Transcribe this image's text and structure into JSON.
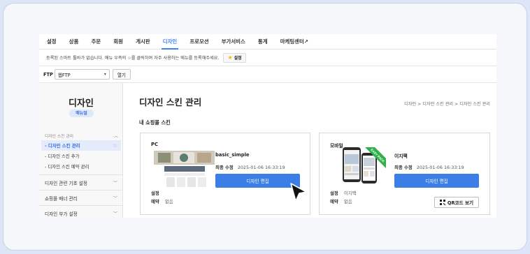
{
  "topnav": {
    "items": [
      "설정",
      "상품",
      "주문",
      "회원",
      "게시판",
      "디자인",
      "프로모션",
      "부가서비스",
      "통계",
      "마케팅센터↗"
    ],
    "active_index": 5
  },
  "notice": {
    "text": "등록된 스마트 툴바가 없습니다. 메뉴 우측의 ☆를 클릭하여 자주 사용하는 메뉴를 등록해주세요.",
    "button_label": "설정"
  },
  "ftp": {
    "label": "FTP",
    "selected": "웹FTP",
    "open_label": "열기"
  },
  "sidebar": {
    "title": "디자인",
    "manual_label": "매뉴얼",
    "section_label": "디자인 스킨 관리",
    "sub_items": [
      "디자인 스킨 관리",
      "디자인 스킨 추가",
      "디자인 스킨 예약 관리"
    ],
    "menus": [
      "디자인 관련 기초 설정",
      "쇼핑몰 배너 관리",
      "디자인 부가 설정"
    ]
  },
  "main": {
    "title": "디자인 스킨 관리",
    "breadcrumb": "디자인 > 디자인 스킨 관리 > 디자인 스킨 관리",
    "section_title": "내 쇼핑몰 스킨",
    "pc": {
      "label": "PC",
      "skin_name": "basic_simple",
      "modified_label": "최종 수정",
      "modified_value": "2025-01-06 16:33:19",
      "edit_label": "디자인 편집",
      "setting_label": "설정",
      "setting_value": "",
      "reserve_label": "예약",
      "reserve_value": "없음"
    },
    "mobile": {
      "label": "모바일",
      "skin_name": "이지팩",
      "badge": "EASY PACK",
      "modified_label": "최종 수정",
      "modified_value": "2025-01-06 16:33:19",
      "edit_label": "디자인 편집",
      "setting_label": "설정",
      "setting_value": "이지팩",
      "reserve_label": "예약",
      "reserve_value": "없음",
      "qr_label": "QR코드 보기"
    }
  },
  "colors": {
    "accent": "#3a7ee6",
    "badge_green": "#2fb14a",
    "background": "#dde6f6"
  }
}
